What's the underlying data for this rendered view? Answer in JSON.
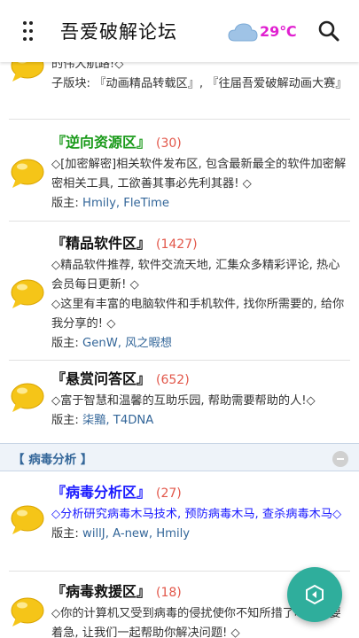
{
  "header": {
    "title": "吾爱破解论坛",
    "weather": {
      "icon": "cloud-icon",
      "temperature": "29℃"
    },
    "menu_icon": "more-vertical-icon",
    "search_icon": "search-icon"
  },
  "forums_top": {
    "partial_desc": "的伟大航路!◇",
    "subforums": "子版块: 『动画精品转载区』, 『往届吾爱破解动画大赛』"
  },
  "forums": [
    {
      "title": "『逆向资源区』",
      "count": "(30)",
      "title_color": "#1a9a1a",
      "desc": "◇[加密解密]相关软件发布区, 包含最新最全的软件加密解密相关工具, 工欲善其事必先利其器! ◇",
      "mods_label": "版主:",
      "mods": "Hmily, FleTime"
    },
    {
      "title": "『精品软件区』",
      "count": "(1427)",
      "title_color": "#111111",
      "desc": "◇精品软件推荐, 软件交流天地, 汇集众多精彩评论, 热心会员每日更新! ◇",
      "desc2": "◇这里有丰富的电脑软件和手机软件, 找你所需要的, 给你我分享的! ◇",
      "mods_label": "版主:",
      "mods": "GenW, 风之暇想"
    },
    {
      "title": "『悬赏问答区』",
      "count": "(652)",
      "title_color": "#111111",
      "desc": "◇富于智慧和温馨的互助乐园, 帮助需要帮助的人!◇",
      "mods_label": "版主:",
      "mods": "柒黯, T4DNA"
    }
  ],
  "section": {
    "title": "【 病毒分析 】"
  },
  "forums_section": [
    {
      "title": "『病毒分析区』",
      "count": "(27)",
      "title_color": "#1a1aff",
      "desc": "◇分析研究病毒木马技术, 预防病毒木马, 查杀病毒木马◇",
      "desc_color": "#1a1aff",
      "mods_label": "版主:",
      "mods": "willJ, A-new, Hmily"
    },
    {
      "title": "『病毒救援区』",
      "count": "(18)",
      "title_color": "#111111",
      "desc": "◇你的计算机又受到病毒的侵扰使你不知所措了吗？不要着急, 让我们一起帮助你解决问题! ◇"
    }
  ],
  "fab": {
    "icon": "back-arrow-icon"
  },
  "colors": {
    "accent": "#2fae9c",
    "link": "#336699",
    "count": "#e2574a",
    "bubble": "#f5c518"
  }
}
